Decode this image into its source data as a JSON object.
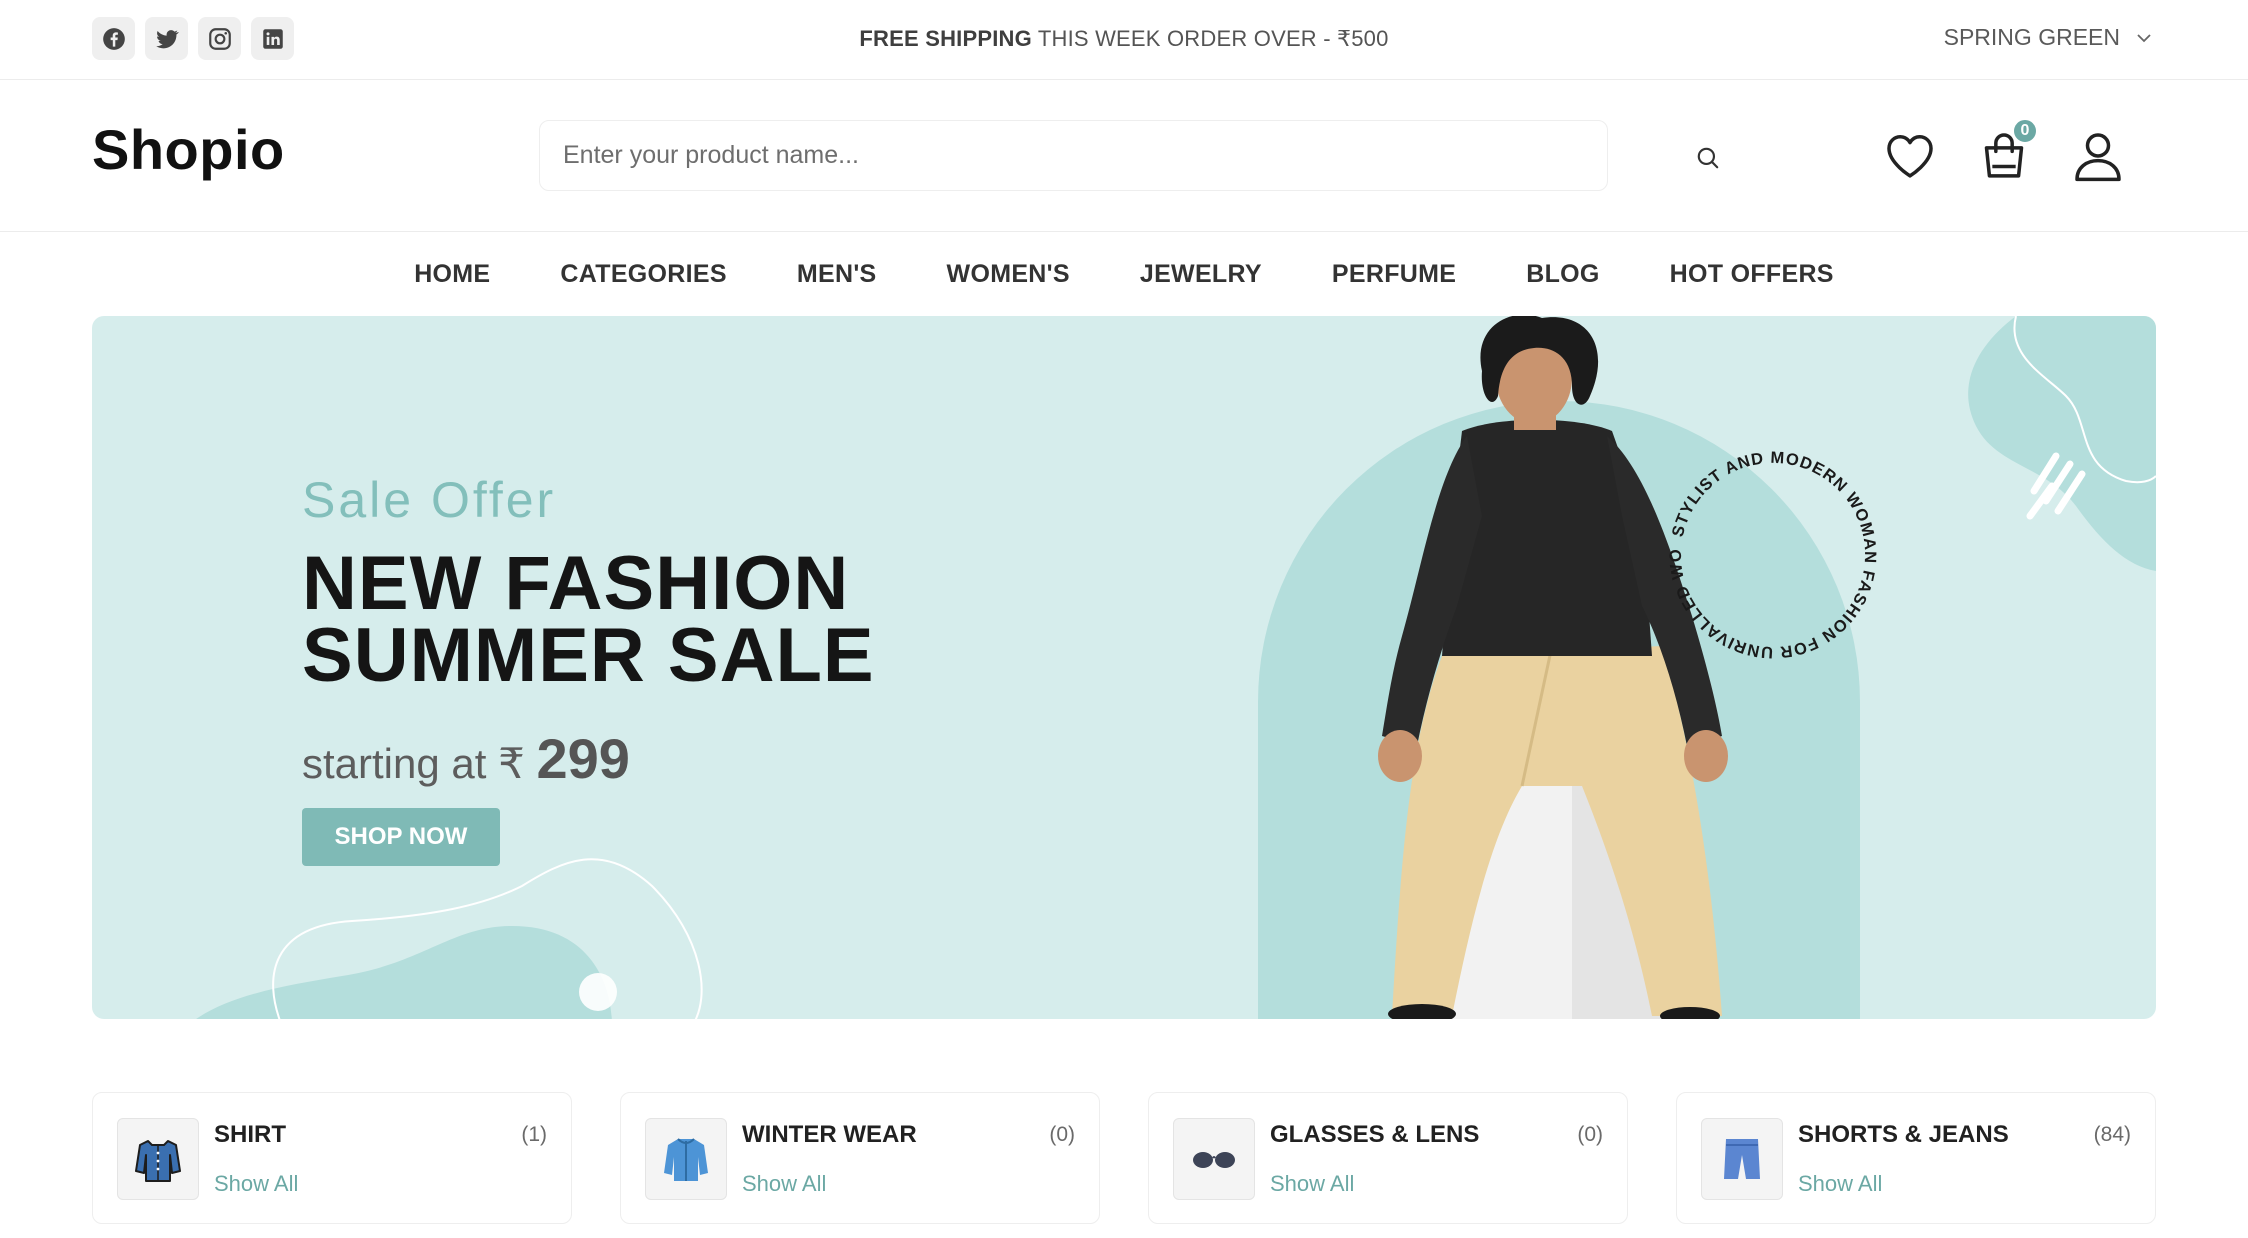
{
  "topbar": {
    "social": [
      {
        "icon": "facebook-icon"
      },
      {
        "icon": "twitter-icon"
      },
      {
        "icon": "instagram-icon"
      },
      {
        "icon": "linkedin-icon"
      }
    ],
    "promo_bold": "FREE SHIPPING",
    "promo_rest": " THIS WEEK ORDER OVER - ₹500",
    "theme_label": "SPRING GREEN"
  },
  "header": {
    "logo": "Shopio",
    "search_placeholder": "Enter your product name...",
    "cart_count": "0"
  },
  "nav": {
    "items": [
      "HOME",
      "CATEGORIES",
      "MEN'S",
      "WOMEN'S",
      "JEWELRY",
      "PERFUME",
      "BLOG",
      "HOT OFFERS"
    ]
  },
  "hero": {
    "subtitle": "Sale Offer",
    "title_line1": "NEW FASHION",
    "title_line2": "SUMMER SALE",
    "price_prefix": "starting at ₹ ",
    "price_amount": "299",
    "button": "SHOP NOW",
    "circle_text": "STYLIST AND MODERN WOMAN FASHION FOR UNRIVALLED WOMAN",
    "accent_color": "#7fbab6"
  },
  "categories": [
    {
      "name": "SHIRT",
      "count": "(1)",
      "link": "Show All",
      "icon": "shirt-icon"
    },
    {
      "name": "WINTER WEAR",
      "count": "(0)",
      "link": "Show All",
      "icon": "jacket-icon"
    },
    {
      "name": "GLASSES & LENS",
      "count": "(0)",
      "link": "Show All",
      "icon": "glasses-icon"
    },
    {
      "name": "SHORTS & JEANS",
      "count": "(84)",
      "link": "Show All",
      "icon": "shorts-icon"
    }
  ]
}
